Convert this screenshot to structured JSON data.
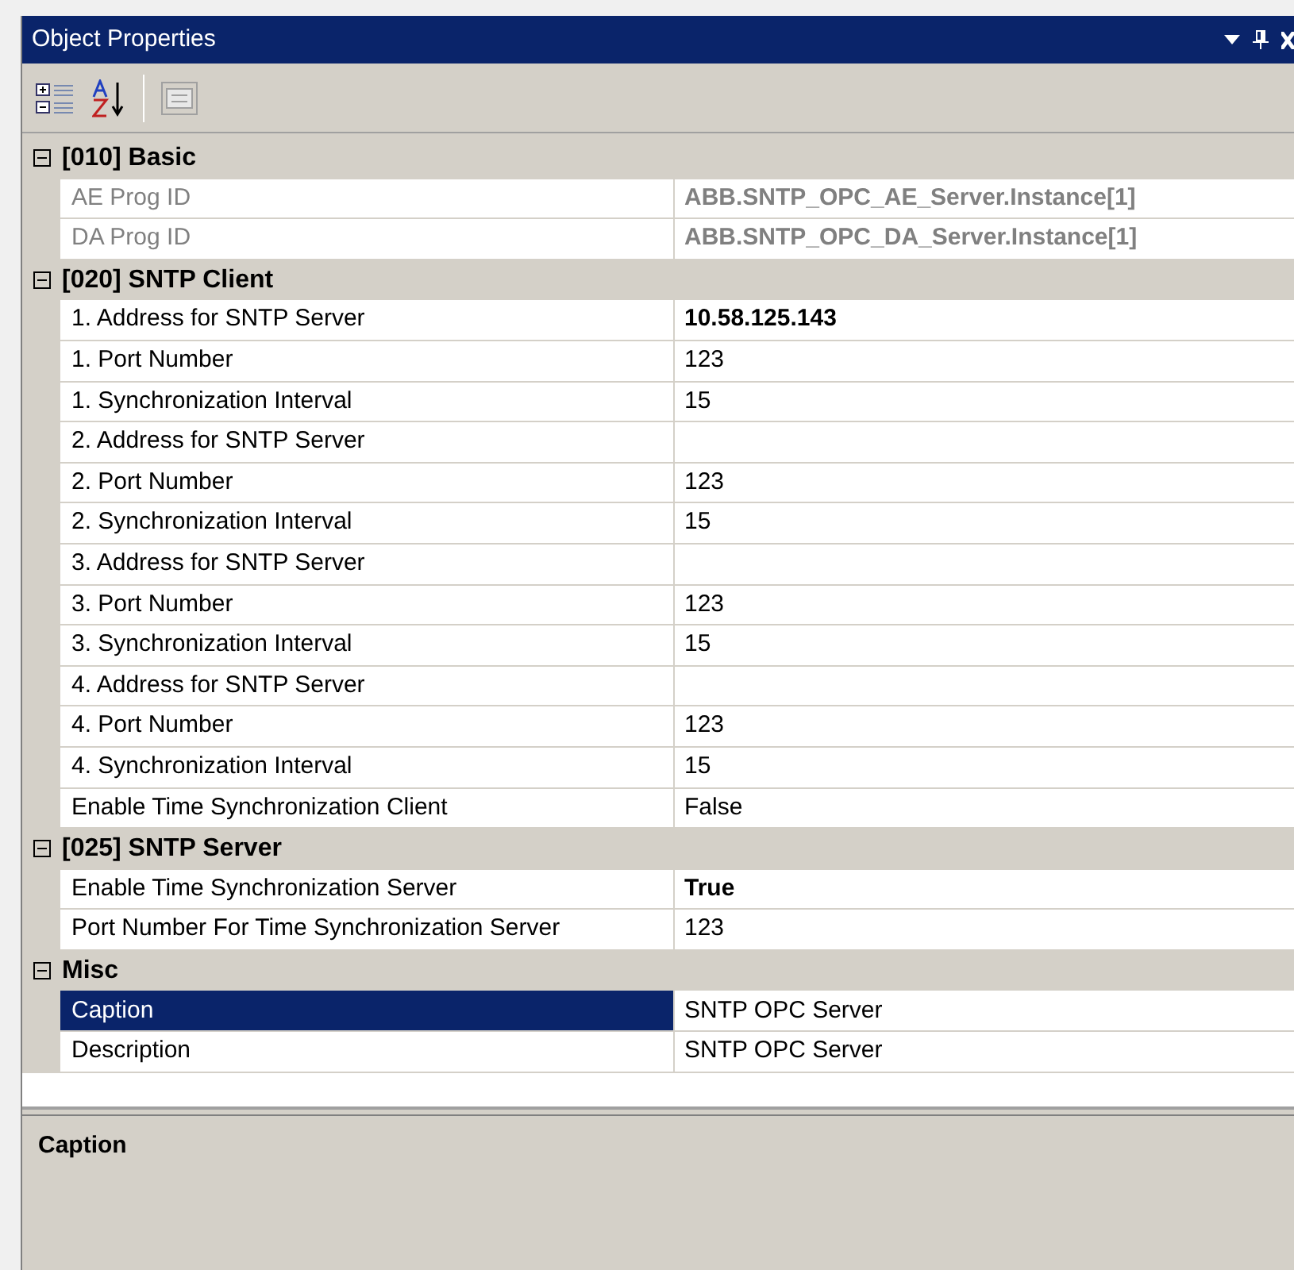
{
  "window": {
    "title": "Object Properties"
  },
  "categories": [
    {
      "title": "[010] Basic",
      "expanded": true,
      "properties": [
        {
          "name": "AE Prog ID",
          "value": "ABB.SNTP_OPC_AE_Server.Instance[1]",
          "disabled": true,
          "modified": true,
          "selected": false
        },
        {
          "name": "DA Prog ID",
          "value": "ABB.SNTP_OPC_DA_Server.Instance[1]",
          "disabled": true,
          "modified": true,
          "selected": false
        }
      ]
    },
    {
      "title": "[020] SNTP Client",
      "expanded": true,
      "properties": [
        {
          "name": "1. Address for SNTP Server",
          "value": "10.58.125.143",
          "disabled": false,
          "modified": true,
          "selected": false
        },
        {
          "name": "1. Port Number",
          "value": "123",
          "disabled": false,
          "modified": false,
          "selected": false
        },
        {
          "name": "1. Synchronization Interval",
          "value": "15",
          "disabled": false,
          "modified": false,
          "selected": false
        },
        {
          "name": "2. Address for SNTP Server",
          "disabled": false,
          "selected": false
        },
        {
          "name": "2. Port Number",
          "value": "123",
          "disabled": false,
          "modified": false,
          "selected": false
        },
        {
          "name": "2. Synchronization Interval",
          "value": "15",
          "disabled": false,
          "modified": false,
          "selected": false
        },
        {
          "name": "3. Address for SNTP Server",
          "disabled": false,
          "selected": false
        },
        {
          "name": "3. Port Number",
          "value": "123",
          "disabled": false,
          "modified": false,
          "selected": false
        },
        {
          "name": "3. Synchronization Interval",
          "value": "15",
          "disabled": false,
          "modified": false,
          "selected": false
        },
        {
          "name": "4. Address for SNTP Server",
          "disabled": false,
          "selected": false
        },
        {
          "name": "4. Port Number",
          "value": "123",
          "disabled": false,
          "modified": false,
          "selected": false
        },
        {
          "name": "4. Synchronization Interval",
          "value": "15",
          "disabled": false,
          "modified": false,
          "selected": false
        },
        {
          "name": "Enable Time Synchronization Client",
          "value": "False",
          "disabled": false,
          "modified": false,
          "selected": false
        }
      ]
    },
    {
      "title": "[025] SNTP Server",
      "expanded": true,
      "properties": [
        {
          "name": "Enable Time Synchronization Server",
          "value": "True",
          "disabled": false,
          "modified": true,
          "selected": false
        },
        {
          "name": "Port Number For Time Synchronization Server",
          "value": "123",
          "disabled": false,
          "modified": false,
          "selected": false
        }
      ]
    },
    {
      "title": "Misc",
      "expanded": true,
      "properties": [
        {
          "name": "Caption",
          "value": "SNTP OPC Server",
          "disabled": false,
          "modified": false,
          "selected": true
        },
        {
          "name": "Description",
          "value": "SNTP OPC Server",
          "disabled": false,
          "modified": false,
          "selected": false
        }
      ]
    }
  ],
  "help": {
    "title": "Caption"
  }
}
